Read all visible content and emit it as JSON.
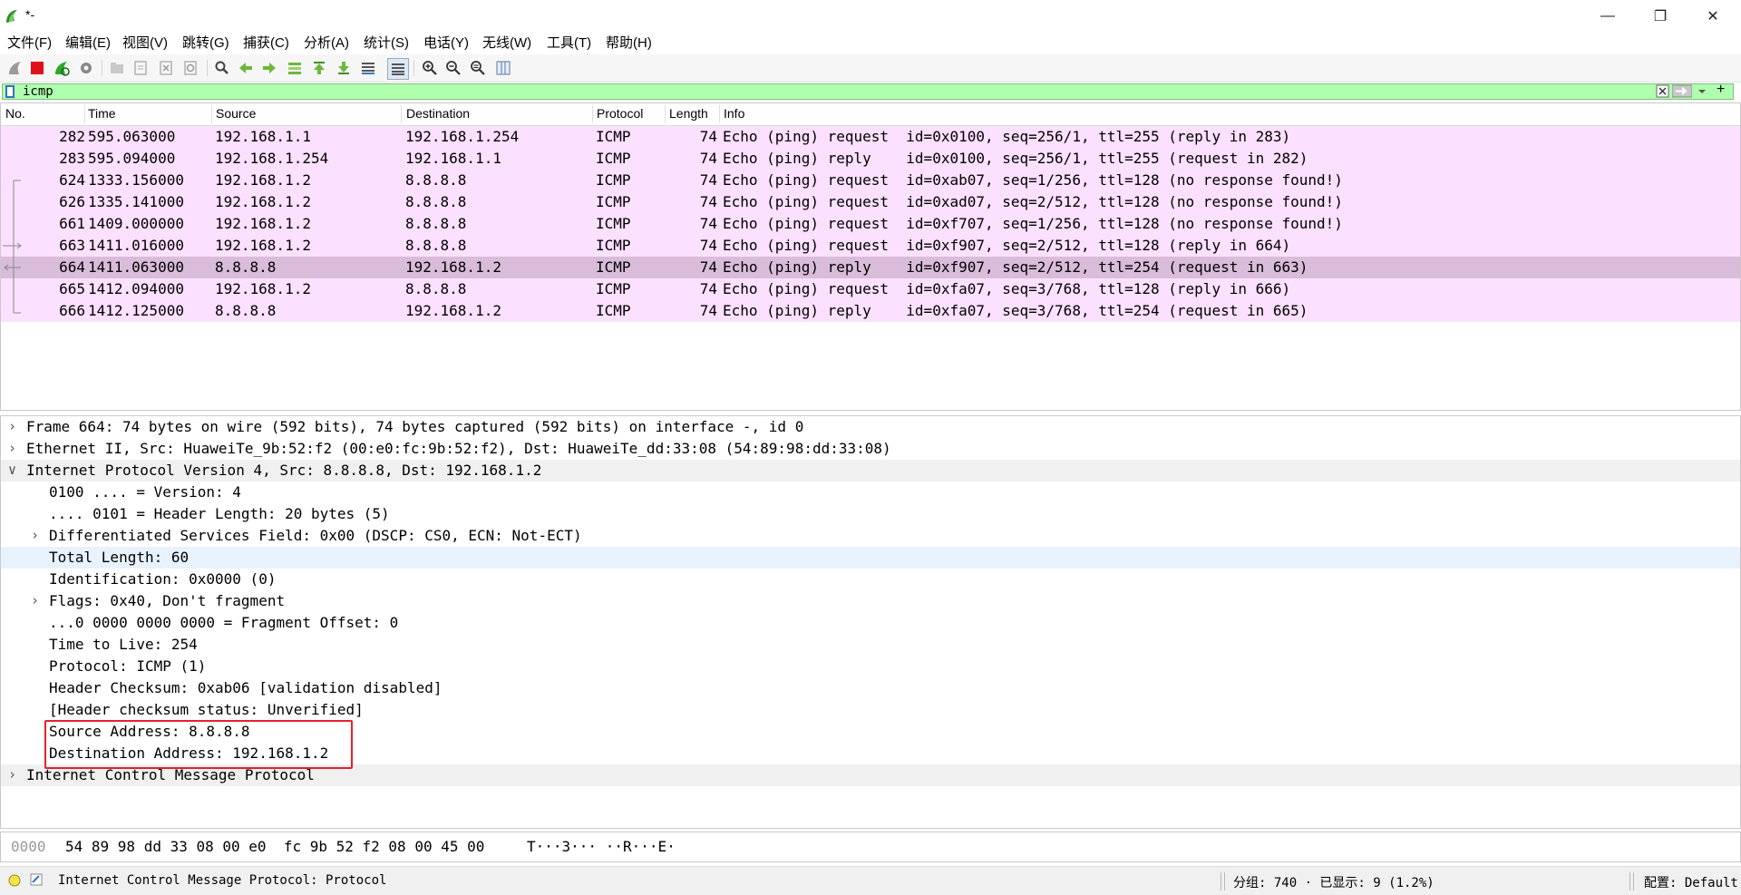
{
  "window": {
    "title": "*-",
    "minimize": "—",
    "restore": "❐",
    "close": "✕"
  },
  "menu": [
    {
      "label": "文件(F)"
    },
    {
      "label": "编辑(E)"
    },
    {
      "label": "视图(V)"
    },
    {
      "label": "跳转(G)"
    },
    {
      "label": "捕获(C)"
    },
    {
      "label": "分析(A)"
    },
    {
      "label": "统计(S)"
    },
    {
      "label": "电话(Y)"
    },
    {
      "label": "无线(W)"
    },
    {
      "label": "工具(T)"
    },
    {
      "label": "帮助(H)"
    }
  ],
  "toolbar": {
    "icons": [
      "shark-fin-start-icon",
      "stop-capture-icon",
      "restart-capture-icon",
      "capture-options-icon",
      "open-file-icon",
      "save-file-icon",
      "close-file-icon",
      "reload-file-icon",
      "find-packet-icon",
      "go-back-icon",
      "go-forward-icon",
      "go-to-packet-icon",
      "go-first-icon",
      "go-last-icon",
      "auto-scroll-icon",
      "colorize-icon",
      "zoom-in-icon",
      "zoom-out-icon",
      "normal-size-icon",
      "resize-columns-icon"
    ]
  },
  "filter": {
    "value": "icmp",
    "color": "#afffaf",
    "plus": "+"
  },
  "packet_list": {
    "columns": [
      "No.",
      "Time",
      "Source",
      "Destination",
      "Protocol",
      "Length",
      "Info"
    ],
    "rows": [
      {
        "no": "282",
        "time": "595.063000",
        "src": "192.168.1.1",
        "dst": "192.168.1.254",
        "proto": "ICMP",
        "len": "74",
        "info": "Echo (ping) request  id=0x0100, seq=256/1, ttl=255 (reply in 283)",
        "selected": false
      },
      {
        "no": "283",
        "time": "595.094000",
        "src": "192.168.1.254",
        "dst": "192.168.1.1",
        "proto": "ICMP",
        "len": "74",
        "info": "Echo (ping) reply    id=0x0100, seq=256/1, ttl=255 (request in 282)",
        "selected": false
      },
      {
        "no": "624",
        "time": "1333.156000",
        "src": "192.168.1.2",
        "dst": "8.8.8.8",
        "proto": "ICMP",
        "len": "74",
        "info": "Echo (ping) request  id=0xab07, seq=1/256, ttl=128 (no response found!)",
        "selected": false
      },
      {
        "no": "626",
        "time": "1335.141000",
        "src": "192.168.1.2",
        "dst": "8.8.8.8",
        "proto": "ICMP",
        "len": "74",
        "info": "Echo (ping) request  id=0xad07, seq=2/512, ttl=128 (no response found!)",
        "selected": false
      },
      {
        "no": "661",
        "time": "1409.000000",
        "src": "192.168.1.2",
        "dst": "8.8.8.8",
        "proto": "ICMP",
        "len": "74",
        "info": "Echo (ping) request  id=0xf707, seq=1/256, ttl=128 (no response found!)",
        "selected": false
      },
      {
        "no": "663",
        "time": "1411.016000",
        "src": "192.168.1.2",
        "dst": "8.8.8.8",
        "proto": "ICMP",
        "len": "74",
        "info": "Echo (ping) request  id=0xf907, seq=2/512, ttl=128 (reply in 664)",
        "selected": false
      },
      {
        "no": "664",
        "time": "1411.063000",
        "src": "8.8.8.8",
        "dst": "192.168.1.2",
        "proto": "ICMP",
        "len": "74",
        "info": "Echo (ping) reply    id=0xf907, seq=2/512, ttl=254 (request in 663)",
        "selected": true
      },
      {
        "no": "665",
        "time": "1412.094000",
        "src": "192.168.1.2",
        "dst": "8.8.8.8",
        "proto": "ICMP",
        "len": "74",
        "info": "Echo (ping) request  id=0xfa07, seq=3/768, ttl=128 (reply in 666)",
        "selected": false
      },
      {
        "no": "666",
        "time": "1412.125000",
        "src": "8.8.8.8",
        "dst": "192.168.1.2",
        "proto": "ICMP",
        "len": "74",
        "info": "Echo (ping) reply    id=0xfa07, seq=3/768, ttl=254 (request in 665)",
        "selected": false
      }
    ],
    "row_color": "#fce0ff",
    "selected_color": "#d9bcd9"
  },
  "details": {
    "rows": [
      {
        "arrow": ">",
        "indent": 0,
        "text": "Frame 664: 74 bytes on wire (592 bits), 74 bytes captured (592 bits) on interface -, id 0",
        "style": ""
      },
      {
        "arrow": ">",
        "indent": 0,
        "text": "Ethernet II, Src: HuaweiTe_9b:52:f2 (00:e0:fc:9b:52:f2), Dst: HuaweiTe_dd:33:08 (54:89:98:dd:33:08)",
        "style": ""
      },
      {
        "arrow": "v",
        "indent": 0,
        "text": "Internet Protocol Version 4, Src: 8.8.8.8, Dst: 192.168.1.2",
        "style": "grey"
      },
      {
        "arrow": "",
        "indent": 1,
        "text": "0100 .... = Version: 4",
        "style": ""
      },
      {
        "arrow": "",
        "indent": 1,
        "text": ".... 0101 = Header Length: 20 bytes (5)",
        "style": ""
      },
      {
        "arrow": ">",
        "indent": 1,
        "text": "Differentiated Services Field: 0x00 (DSCP: CS0, ECN: Not-ECT)",
        "style": ""
      },
      {
        "arrow": "",
        "indent": 1,
        "text": "Total Length: 60",
        "style": "hl"
      },
      {
        "arrow": "",
        "indent": 1,
        "text": "Identification: 0x0000 (0)",
        "style": ""
      },
      {
        "arrow": ">",
        "indent": 1,
        "text": "Flags: 0x40, Don't fragment",
        "style": ""
      },
      {
        "arrow": "",
        "indent": 1,
        "text": "...0 0000 0000 0000 = Fragment Offset: 0",
        "style": ""
      },
      {
        "arrow": "",
        "indent": 1,
        "text": "Time to Live: 254",
        "style": ""
      },
      {
        "arrow": "",
        "indent": 1,
        "text": "Protocol: ICMP (1)",
        "style": ""
      },
      {
        "arrow": "",
        "indent": 1,
        "text": "Header Checksum: 0xab06 [validation disabled]",
        "style": ""
      },
      {
        "arrow": "",
        "indent": 1,
        "text": "[Header checksum status: Unverified]",
        "style": ""
      },
      {
        "arrow": "",
        "indent": 1,
        "text": "Source Address: 8.8.8.8",
        "style": ""
      },
      {
        "arrow": "",
        "indent": 1,
        "text": "Destination Address: 192.168.1.2",
        "style": ""
      },
      {
        "arrow": ">",
        "indent": 0,
        "text": "Internet Control Message Protocol",
        "style": "grey"
      }
    ],
    "highlight_color": "#e8202a"
  },
  "bytes": {
    "offset": "0000",
    "hex": "54 89 98 dd 33 08 00 e0  fc 9b 52 f2 08 00 45 00",
    "ascii": "T···3··· ··R···E·"
  },
  "status": {
    "field": "Internet Control Message Protocol: Protocol",
    "packets": "分组: 740 · 已显示: 9 (1.2%)",
    "profile": "配置: Default"
  }
}
